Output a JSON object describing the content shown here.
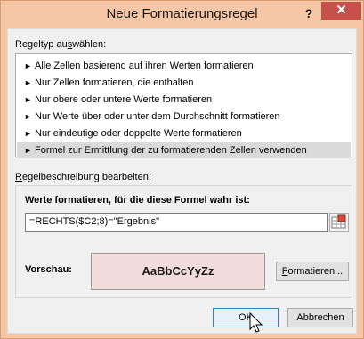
{
  "window": {
    "title": "Neue Formatierungsregel",
    "help_label": "?",
    "close_label": "✕"
  },
  "rule_type": {
    "label_before": "Regeltyp au",
    "label_accel": "s",
    "label_after": "wählen:",
    "items": [
      "Alle Zellen basierend auf ihren Werten formatieren",
      "Nur Zellen formatieren, die enthalten",
      "Nur obere oder untere Werte formatieren",
      "Nur Werte über oder unter dem Durchschnitt formatieren",
      "Nur eindeutige oder doppelte Werte formatieren",
      "Formel zur Ermittlung der zu formatierenden Zellen verwenden"
    ],
    "selected_index": 5
  },
  "description": {
    "label_accel": "R",
    "label_after": "egelbeschreibung bearbeiten:",
    "formula_heading": "Werte formatieren, für die diese Formel wahr ist:",
    "formula_value": "=RECHTS($C2;8)=\"Ergebnis\"",
    "preview_label": "Vorschau:",
    "preview_sample": "AaBbCcYyZz",
    "preview_fill": "#f2dcdb",
    "format_button_accel": "F",
    "format_button_rest": "ormatieren..."
  },
  "buttons": {
    "ok": "OK",
    "cancel": "Abbrechen"
  },
  "icons": {
    "range_reference": "range-select-icon",
    "cursor": "mouse-pointer-icon"
  }
}
